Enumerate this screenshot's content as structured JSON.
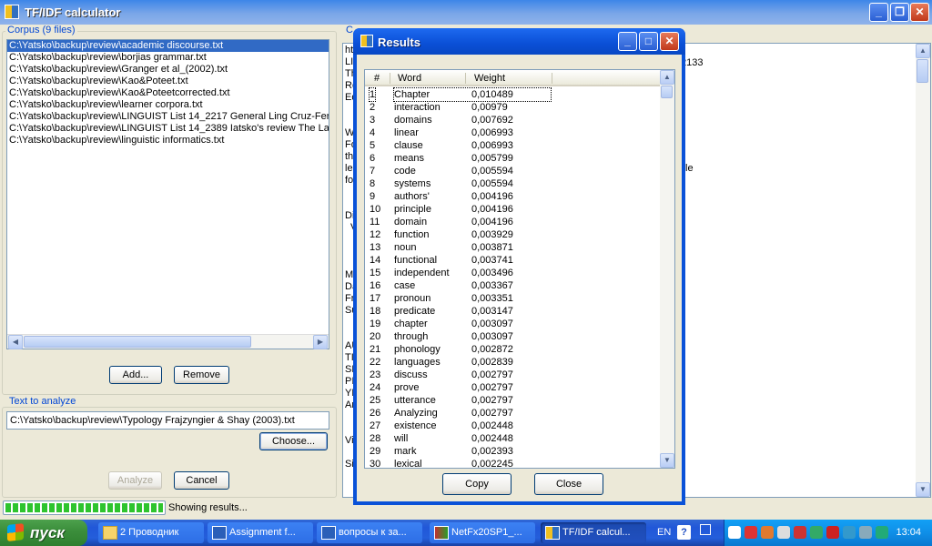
{
  "main_window": {
    "title": "TF/IDF calculator",
    "corpus_label": "Corpus (9 files)",
    "corpus_files": [
      "C:\\Yatsko\\backup\\review\\academic discourse.txt",
      "C:\\Yatsko\\backup\\review\\borjias grammar.txt",
      "C:\\Yatsko\\backup\\review\\Granger et al_(2002).txt",
      "C:\\Yatsko\\backup\\review\\Kao&Poteet.txt",
      "C:\\Yatsko\\backup\\review\\Kao&Poteetcorrected.txt",
      "C:\\Yatsko\\backup\\review\\learner corpora.txt",
      "C:\\Yatsko\\backup\\review\\LINGUIST List 14_2217 General Ling Cruz-Fer",
      "C:\\Yatsko\\backup\\review\\LINGUIST List 14_2389 Iatsko's review The La",
      "C:\\Yatsko\\backup\\review\\linguistic informatics.txt"
    ],
    "add_button": "Add...",
    "remove_button": "Remove",
    "text_label": "Text to analyze",
    "text_path": "C:\\Yatsko\\backup\\review\\Typology Frajzyngier & Shay (2003).txt",
    "choose_button": "Choose...",
    "analyze_button": "Analyze",
    "cancel_button": "Cancel",
    "status_text": "Showing results...",
    "progress_fraction": 1.0,
    "right_panel_label": "C",
    "right_fragments": [
      "htt",
      "LI",
      "Th",
      "Re",
      "Ed",
      "2133",
      "W",
      "Fo",
      "th",
      "lea",
      "fo",
      "le",
      "Di",
      "V",
      "M",
      "Da",
      "Fr",
      "Su",
      "AU",
      "TI",
      "SE",
      "PI",
      "YE",
      "An",
      "Vi",
      "Si"
    ]
  },
  "results_dialog": {
    "title": "Results",
    "col_num": "#",
    "col_word": "Word",
    "col_weight": "Weight",
    "rows": [
      {
        "n": "1",
        "word": "Chapter",
        "weight": "0,010489"
      },
      {
        "n": "2",
        "word": "interaction",
        "weight": "0,00979"
      },
      {
        "n": "3",
        "word": "domains",
        "weight": "0,007692"
      },
      {
        "n": "4",
        "word": "linear",
        "weight": "0,006993"
      },
      {
        "n": "5",
        "word": "clause",
        "weight": "0,006993"
      },
      {
        "n": "6",
        "word": "means",
        "weight": "0,005799"
      },
      {
        "n": "7",
        "word": "code",
        "weight": "0,005594"
      },
      {
        "n": "8",
        "word": "systems",
        "weight": "0,005594"
      },
      {
        "n": "9",
        "word": "authors'",
        "weight": "0,004196"
      },
      {
        "n": "10",
        "word": "principle",
        "weight": "0,004196"
      },
      {
        "n": "11",
        "word": "domain",
        "weight": "0,004196"
      },
      {
        "n": "12",
        "word": "function",
        "weight": "0,003929"
      },
      {
        "n": "13",
        "word": "noun",
        "weight": "0,003871"
      },
      {
        "n": "14",
        "word": "functional",
        "weight": "0,003741"
      },
      {
        "n": "15",
        "word": "independent",
        "weight": "0,003496"
      },
      {
        "n": "16",
        "word": "case",
        "weight": "0,003367"
      },
      {
        "n": "17",
        "word": "pronoun",
        "weight": "0,003351"
      },
      {
        "n": "18",
        "word": "predicate",
        "weight": "0,003147"
      },
      {
        "n": "19",
        "word": "chapter",
        "weight": "0,003097"
      },
      {
        "n": "20",
        "word": "through",
        "weight": "0,003097"
      },
      {
        "n": "21",
        "word": "phonology",
        "weight": "0,002872"
      },
      {
        "n": "22",
        "word": "languages",
        "weight": "0,002839"
      },
      {
        "n": "23",
        "word": "discuss",
        "weight": "0,002797"
      },
      {
        "n": "24",
        "word": "prove",
        "weight": "0,002797"
      },
      {
        "n": "25",
        "word": "utterance",
        "weight": "0,002797"
      },
      {
        "n": "26",
        "word": "Analyzing",
        "weight": "0,002797"
      },
      {
        "n": "27",
        "word": "existence",
        "weight": "0,002448"
      },
      {
        "n": "28",
        "word": "will",
        "weight": "0,002448"
      },
      {
        "n": "29",
        "word": "mark",
        "weight": "0,002393"
      },
      {
        "n": "30",
        "word": "lexical",
        "weight": "0,002245"
      }
    ],
    "copy_button": "Copy",
    "close_button": "Close"
  },
  "taskbar": {
    "start_label": "пуск",
    "buttons": [
      {
        "label": "2 Проводник",
        "icon": "folder-icon"
      },
      {
        "label": "Assignment f...",
        "icon": "word-document-icon"
      },
      {
        "label": "вопросы к за...",
        "icon": "word-document-icon"
      },
      {
        "label": "NetFx20SP1_...",
        "icon": "installer-icon"
      },
      {
        "label": "TF/IDF calcul...",
        "icon": "app-icon"
      }
    ],
    "lang": "EN",
    "clock": "13:04"
  },
  "colors": {
    "titlebar": "#0a52d8",
    "selection": "#316ac5",
    "group_label": "#0046d5",
    "progress": "#2ec42e"
  }
}
